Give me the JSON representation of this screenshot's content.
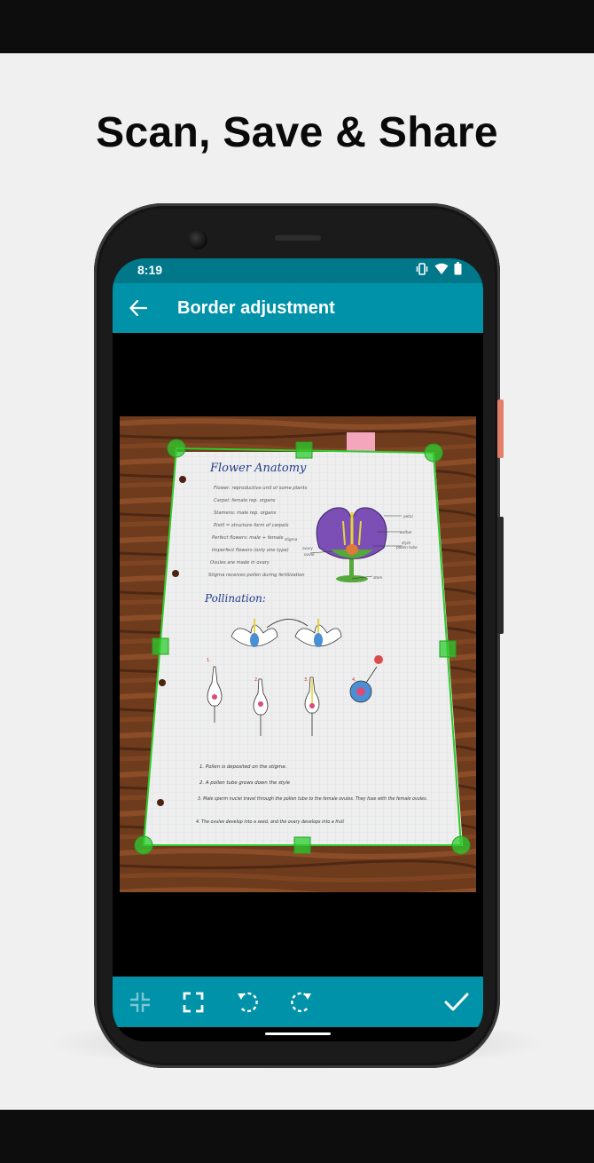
{
  "promo": {
    "title": "Scan, Save & Share"
  },
  "status_bar": {
    "time": "8:19",
    "icons": [
      "vibrate-icon",
      "wifi-icon",
      "battery-icon"
    ]
  },
  "app_bar": {
    "title": "Border adjustment",
    "back_icon": "arrow-left-icon"
  },
  "document": {
    "heading": "Flower Anatomy",
    "list": [
      "Flower: reproductive unit of some plants",
      "Carpel: female rep. organs",
      "Stamens: male rep. organs",
      "Pistil = structure form of carpels",
      "Perfect flowers: male + female",
      "Imperfect flowers (only one type)",
      "Ovules are made in ovary",
      "Stigma receives pollen during fertilization"
    ],
    "diagram_labels": [
      "petal",
      "anther",
      "stigma",
      "style",
      "pollen tube",
      "ovary",
      "ovule",
      "stem"
    ],
    "section": "Pollination:",
    "steps": [
      "1. Pollen is deposited on the stigma.",
      "2. A pollen tube grows down the style",
      "3. Male sperm nuclei travel through the pollen tube to the female ovules. They fuse with the female ovules.",
      "4. The ovules develop into a seed, and the ovary develops into a fruit"
    ],
    "step_markers": [
      "1.",
      "2.",
      "3.",
      "4."
    ]
  },
  "toolbar": {
    "icons": [
      "collapse-icon",
      "fullscreen-icon",
      "rotate-left-icon",
      "rotate-right-icon",
      "check-icon"
    ]
  },
  "colors": {
    "teal": "#0092a8",
    "teal_dark": "#00788a",
    "crop_green": "#2ecc2e"
  }
}
